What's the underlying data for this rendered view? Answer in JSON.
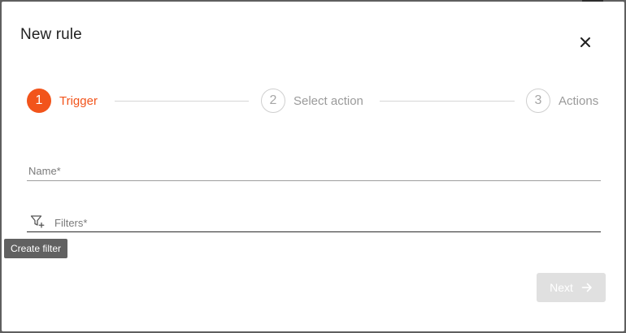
{
  "dialog": {
    "title": "New rule"
  },
  "stepper": {
    "steps": [
      {
        "number": "1",
        "label": "Trigger",
        "state": "active"
      },
      {
        "number": "2",
        "label": "Select action",
        "state": "inactive"
      },
      {
        "number": "3",
        "label": "Actions",
        "state": "inactive"
      }
    ]
  },
  "form": {
    "name_label": "Name*",
    "name_value": "",
    "filters_label": "Filters*",
    "filters_value": ""
  },
  "tooltip": {
    "text": "Create filter"
  },
  "footer": {
    "next_label": "Next",
    "next_enabled": false
  },
  "icons": {
    "close": "close-icon",
    "filter": "filter-add-icon",
    "next_arrow": "arrow-right-icon"
  },
  "colors": {
    "accent": "#f2541b",
    "inactive": "#cfcfcf",
    "disabled_button": "#e0e0e0",
    "tooltip_bg": "#616161"
  }
}
